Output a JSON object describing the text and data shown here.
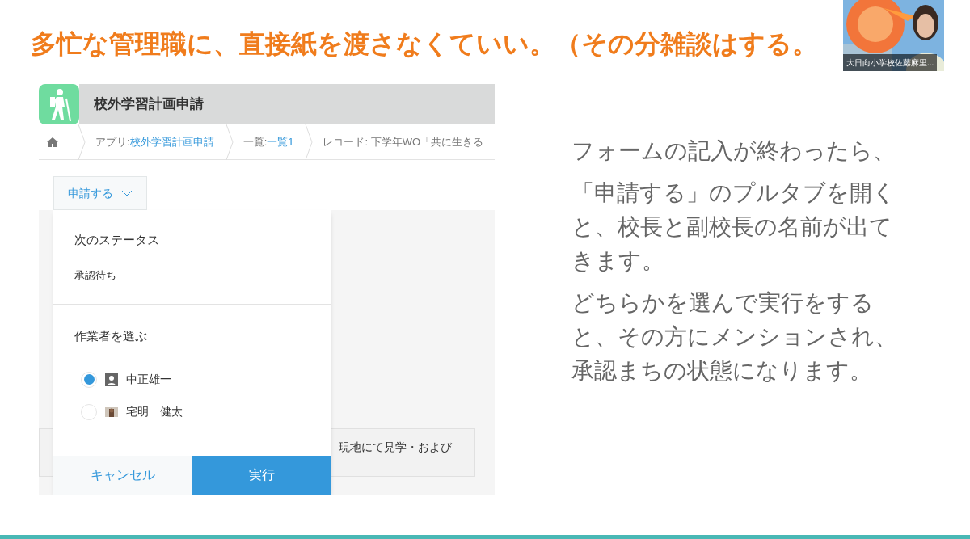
{
  "slide": {
    "title": "多忙な管理職に、直接紙を渡さなくていい。（その分雑談はする。",
    "app": {
      "title": "校外学習計画申請",
      "breadcrumbs": [
        {
          "label": "アプリ: ",
          "link": "校外学習計画申請"
        },
        {
          "label": "一覧: ",
          "link": "一覧1"
        },
        {
          "label": "レコード: 下学年WO「共に生きる"
        }
      ],
      "action_button": "申請する",
      "popup": {
        "status_heading": "次のステータス",
        "status_value": "承認待ち",
        "assignee_heading": "作業者を選ぶ",
        "assignees": [
          {
            "name": "中正雄一",
            "selected": true,
            "kind": "generic"
          },
          {
            "name": "宅明　健太",
            "selected": false
          }
        ],
        "cancel": "キャンセル",
        "execute": "実行"
      },
      "field_text": "現地にて見学・および"
    },
    "paragraphs": [
      "フォームの記入が終わったら、",
      "「申請する」のプルタブを開くと、校長と副校長の名前が出てきます。",
      "どちらかを選んで実行をすると、その方にメンションされ、承認まちの状態になります。"
    ],
    "video": {
      "caption": "大日向小学校佐藤麻里..."
    }
  }
}
